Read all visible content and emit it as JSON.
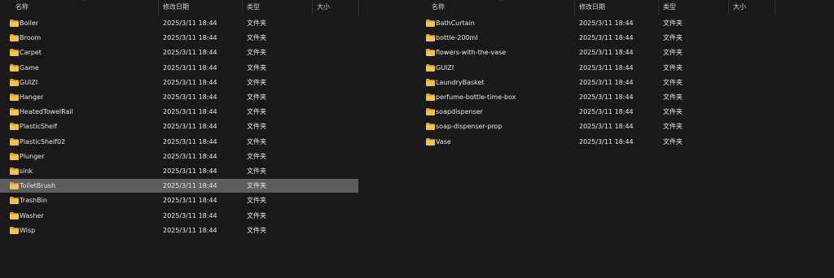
{
  "columns": {
    "name": "名称",
    "modified": "修改日期",
    "type": "类型",
    "size": "大小"
  },
  "sort_indicator": "^",
  "left_pane": {
    "items": [
      {
        "name": "Boiler",
        "modified": "2025/3/11 18:44",
        "type": "文件夹",
        "size": ""
      },
      {
        "name": "Broom",
        "modified": "2025/3/11 18:44",
        "type": "文件夹",
        "size": ""
      },
      {
        "name": "Carpet",
        "modified": "2025/3/11 18:44",
        "type": "文件夹",
        "size": ""
      },
      {
        "name": "Game",
        "modified": "2025/3/11 18:44",
        "type": "文件夹",
        "size": ""
      },
      {
        "name": "GUIZI",
        "modified": "2025/3/11 18:44",
        "type": "文件夹",
        "size": ""
      },
      {
        "name": "Hanger",
        "modified": "2025/3/11 18:44",
        "type": "文件夹",
        "size": ""
      },
      {
        "name": "HeatedTowelRail",
        "modified": "2025/3/11 18:44",
        "type": "文件夹",
        "size": ""
      },
      {
        "name": "PlasticShelf",
        "modified": "2025/3/11 18:44",
        "type": "文件夹",
        "size": ""
      },
      {
        "name": "PlasticShelf02",
        "modified": "2025/3/11 18:44",
        "type": "文件夹",
        "size": ""
      },
      {
        "name": "Plunger",
        "modified": "2025/3/11 18:44",
        "type": "文件夹",
        "size": ""
      },
      {
        "name": "sink",
        "modified": "2025/3/11 18:44",
        "type": "文件夹",
        "size": ""
      },
      {
        "name": "ToiletBrush",
        "modified": "2025/3/11 18:44",
        "type": "文件夹",
        "size": "",
        "selected": true
      },
      {
        "name": "TrashBin",
        "modified": "2025/3/11 18:44",
        "type": "文件夹",
        "size": ""
      },
      {
        "name": "Washer",
        "modified": "2025/3/11 18:44",
        "type": "文件夹",
        "size": ""
      },
      {
        "name": "Wisp",
        "modified": "2025/3/11 18:44",
        "type": "文件夹",
        "size": ""
      }
    ]
  },
  "right_pane": {
    "items": [
      {
        "name": "BathCurtain",
        "modified": "2025/3/11 18:44",
        "type": "文件夹",
        "size": ""
      },
      {
        "name": "bottle-200ml",
        "modified": "2025/3/11 18:44",
        "type": "文件夹",
        "size": ""
      },
      {
        "name": "flowers-with-the-vase",
        "modified": "2025/3/11 18:44",
        "type": "文件夹",
        "size": ""
      },
      {
        "name": "GUIZI",
        "modified": "2025/3/11 18:44",
        "type": "文件夹",
        "size": ""
      },
      {
        "name": "LaundryBasket",
        "modified": "2025/3/11 18:44",
        "type": "文件夹",
        "size": ""
      },
      {
        "name": "perfume-bottle-time-box",
        "modified": "2025/3/11 18:44",
        "type": "文件夹",
        "size": ""
      },
      {
        "name": "soapdispenser",
        "modified": "2025/3/11 18:44",
        "type": "文件夹",
        "size": ""
      },
      {
        "name": "soap-dispenser-prop",
        "modified": "2025/3/11 18:44",
        "type": "文件夹",
        "size": ""
      },
      {
        "name": "Vase",
        "modified": "2025/3/11 18:44",
        "type": "文件夹",
        "size": ""
      }
    ]
  },
  "colors": {
    "background": "#191919",
    "selected_row": "#5d5d5d",
    "folder": "#f4c04e",
    "folder_dark": "#d9a23a"
  },
  "icons": {
    "folder": "folder-icon",
    "sort": "sort-ascending-icon"
  }
}
